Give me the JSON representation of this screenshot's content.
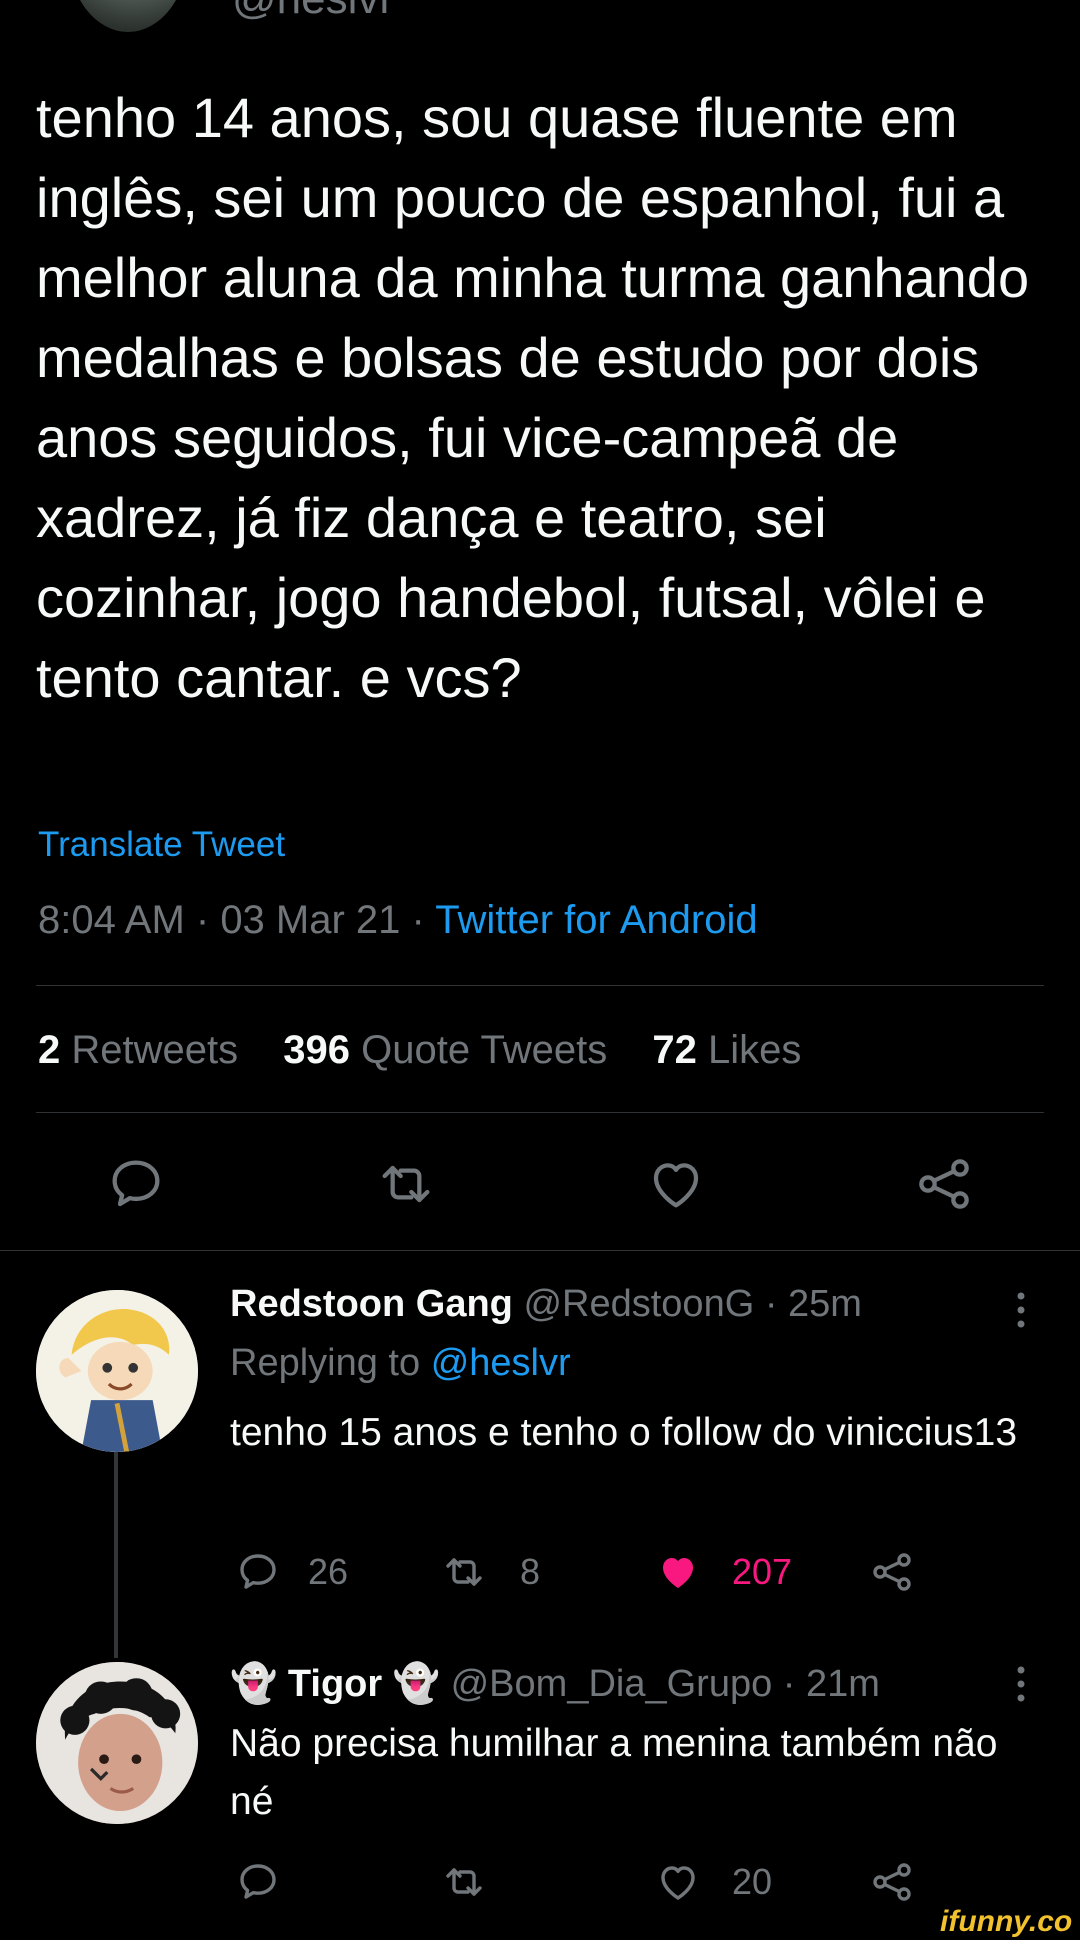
{
  "header": {
    "handle_partial": "@heslvr"
  },
  "tweet": {
    "text": "tenho 14 anos, sou quase fluente em inglês, sei um pouco de espanhol, fui a melhor aluna da minha turma ganhando medalhas e bolsas de estudo por dois anos seguidos, fui vice-campeã de xadrez, já fiz dança e teatro, sei cozinhar, jogo handebol, futsal, vôlei e tento cantar. e vcs?",
    "translate_label": "Translate Tweet",
    "time": "8:04 AM",
    "date": "03 Mar 21",
    "source": "Twitter for Android",
    "separator": " · ",
    "stats": {
      "retweets_count": "2",
      "retweets_label": "Retweets",
      "quotes_count": "396",
      "quotes_label": "Quote Tweets",
      "likes_count": "72",
      "likes_label": "Likes"
    },
    "actions": [
      "reply-icon",
      "retweet-icon",
      "like-icon",
      "share-icon"
    ]
  },
  "replies": [
    {
      "name": "Redstoon Gang",
      "handle": "@RedstoonG",
      "time": "· 25m",
      "replying_prefix": "Replying to",
      "replying_to": "@heslvr",
      "text": "tenho 15 anos e tenho o follow do viniccius13",
      "reply_count": "26",
      "retweet_count": "8",
      "like_count": "207",
      "liked": true
    },
    {
      "name": "👻 Tigor 👻",
      "handle": "@Bom_Dia_Grupo",
      "time": "· 21m",
      "text": "Não precisa humilhar a menina também não né",
      "like_count": "20",
      "liked": false
    }
  ],
  "watermark": "ifunny.co",
  "colors": {
    "accent": "#1d9bf0",
    "like": "#f91880",
    "muted": "#71767b",
    "background": "#000000"
  }
}
